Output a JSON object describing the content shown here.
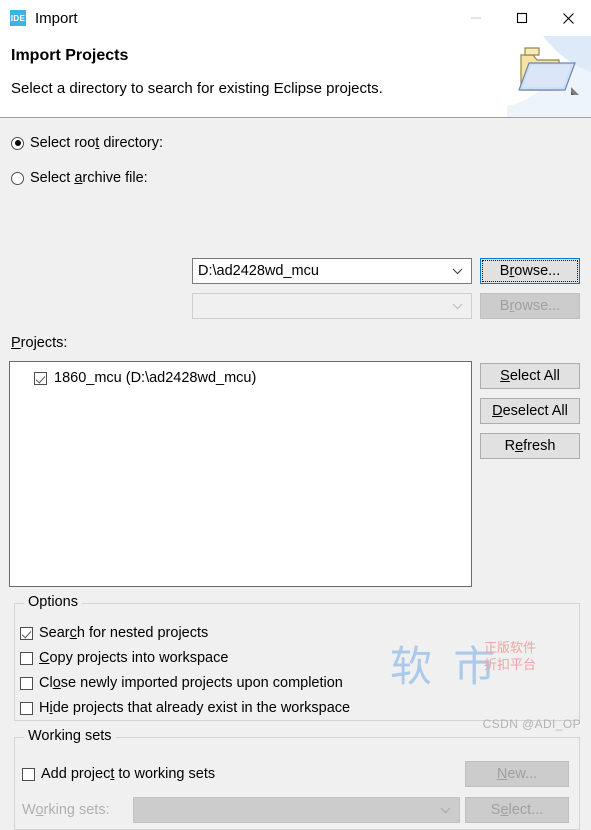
{
  "window": {
    "title": "Import",
    "app_icon_text": "IDE",
    "controls": {
      "minimize": "minimize-button",
      "maximize": "maximize-button",
      "close": "close-button"
    }
  },
  "header": {
    "title": "Import Projects",
    "subtitle": "Select a directory to search for existing Eclipse projects.",
    "banner_icon": "open-folder-icon"
  },
  "source": {
    "root_directory": {
      "label_pre": "Select roo",
      "label_mnemonic": "t",
      "label_post": " directory:",
      "selected": true,
      "value": "D:\\ad2428wd_mcu",
      "browse_pre": "B",
      "browse_mnemonic": "r",
      "browse_post": "owse...",
      "browse_focused": true
    },
    "archive_file": {
      "label_pre": "Select ",
      "label_mnemonic": "a",
      "label_post": "rchive file:",
      "selected": false,
      "value": "",
      "browse_pre": "B",
      "browse_mnemonic": "r",
      "browse_post": "owse...",
      "browse_disabled": true
    }
  },
  "projects": {
    "label_mnemonic": "P",
    "label_post": "rojects:",
    "items": [
      {
        "label": "1860_mcu (D:\\ad2428wd_mcu)",
        "checked": true
      }
    ],
    "buttons": [
      {
        "pre": "",
        "mnemonic": "S",
        "post": "elect All"
      },
      {
        "pre": "",
        "mnemonic": "D",
        "post": "eselect All"
      },
      {
        "pre": "R",
        "mnemonic": "e",
        "post": "fresh"
      }
    ]
  },
  "options": {
    "title": "Options",
    "items": [
      {
        "pre": "Sear",
        "mnemonic": "c",
        "post": "h for nested projects",
        "checked": true
      },
      {
        "pre": "",
        "mnemonic": "C",
        "post": "opy projects into workspace",
        "checked": false
      },
      {
        "pre": "Cl",
        "mnemonic": "o",
        "post": "se newly imported projects upon completion",
        "checked": false
      },
      {
        "pre": "H",
        "mnemonic": "i",
        "post": "de projects that already exist in the workspace",
        "checked": false
      }
    ]
  },
  "working_sets": {
    "title": "Working sets",
    "add_checkbox": {
      "pre": "Add projec",
      "mnemonic": "t",
      "post": " to working sets",
      "checked": false
    },
    "new_button": {
      "pre": "",
      "mnemonic": "N",
      "post": "ew...",
      "disabled": true
    },
    "combo_label_pre": "W",
    "combo_label_mnemonic": "o",
    "combo_label_post": "rking sets:",
    "combo_value": "",
    "select_button": {
      "pre": "S",
      "mnemonic": "e",
      "post": "lect...",
      "disabled": true
    }
  },
  "watermark": {
    "cn_text": "软 市",
    "red_line1": "正版软件",
    "red_line2": "折扣平台",
    "credit": "CSDN @ADI_OP"
  },
  "colors": {
    "accent": "#0078d7",
    "dialog_bg": "#f0f0f0",
    "header_bg": "#ffffff",
    "button_bg": "#e1e1e1"
  }
}
